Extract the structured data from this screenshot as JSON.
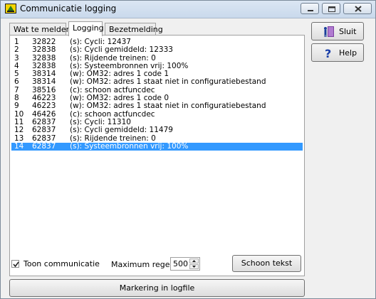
{
  "window": {
    "title": "Communicatie logging"
  },
  "tabs": [
    {
      "label": "Wat te melden",
      "active": false
    },
    {
      "label": "Logging",
      "active": true
    },
    {
      "label": "Bezetmelding",
      "active": false
    }
  ],
  "log": {
    "rows": [
      {
        "num": "1",
        "time": "32822",
        "msg": "(s): Cycli: 12437",
        "selected": false
      },
      {
        "num": "2",
        "time": "32838",
        "msg": "(s): Cycli gemiddeld:  12333",
        "selected": false
      },
      {
        "num": "3",
        "time": "32838",
        "msg": "(s): Rijdende treinen: 0",
        "selected": false
      },
      {
        "num": "4",
        "time": "32838",
        "msg": "(s): Systeembronnen vrij:  100%",
        "selected": false
      },
      {
        "num": "5",
        "time": "38314",
        "msg": "(w): OM32: adres 1 code 1",
        "selected": false
      },
      {
        "num": "6",
        "time": "38314",
        "msg": "(w): OM32: adres 1 staat niet in configuratiebestand",
        "selected": false
      },
      {
        "num": "7",
        "time": "38516",
        "msg": "(c): schoon actfuncdec",
        "selected": false
      },
      {
        "num": "8",
        "time": "46223",
        "msg": "(w): OM32: adres 1 code 0",
        "selected": false
      },
      {
        "num": "9",
        "time": "46223",
        "msg": "(w): OM32: adres 1 staat niet in configuratiebestand",
        "selected": false
      },
      {
        "num": "10",
        "time": "46426",
        "msg": "(c): schoon actfuncdec",
        "selected": false
      },
      {
        "num": "11",
        "time": "62837",
        "msg": "(s): Cycli: 11310",
        "selected": false
      },
      {
        "num": "12",
        "time": "62837",
        "msg": "(s): Cycli gemiddeld:  11479",
        "selected": false
      },
      {
        "num": "13",
        "time": "62837",
        "msg": "(s): Rijdende treinen: 0",
        "selected": false
      },
      {
        "num": "14",
        "time": "62837",
        "msg": "(s): Systeembronnen vrij:  100%",
        "selected": true
      }
    ]
  },
  "controls": {
    "toon_communicatie_label": "Toon communicatie",
    "toon_communicatie_checked": true,
    "maximum_regels_label": "Maximum regels:",
    "maximum_regels_value": "500",
    "schoon_tekst_label": "Schoon tekst",
    "markering_label": "Markering in logfile"
  },
  "side": {
    "sluit_label": "Sluit",
    "help_label": "Help"
  },
  "colors": {
    "selection": "#3399ff",
    "panel_bg": "#ffffff",
    "window_bg": "#f0f0f0"
  }
}
